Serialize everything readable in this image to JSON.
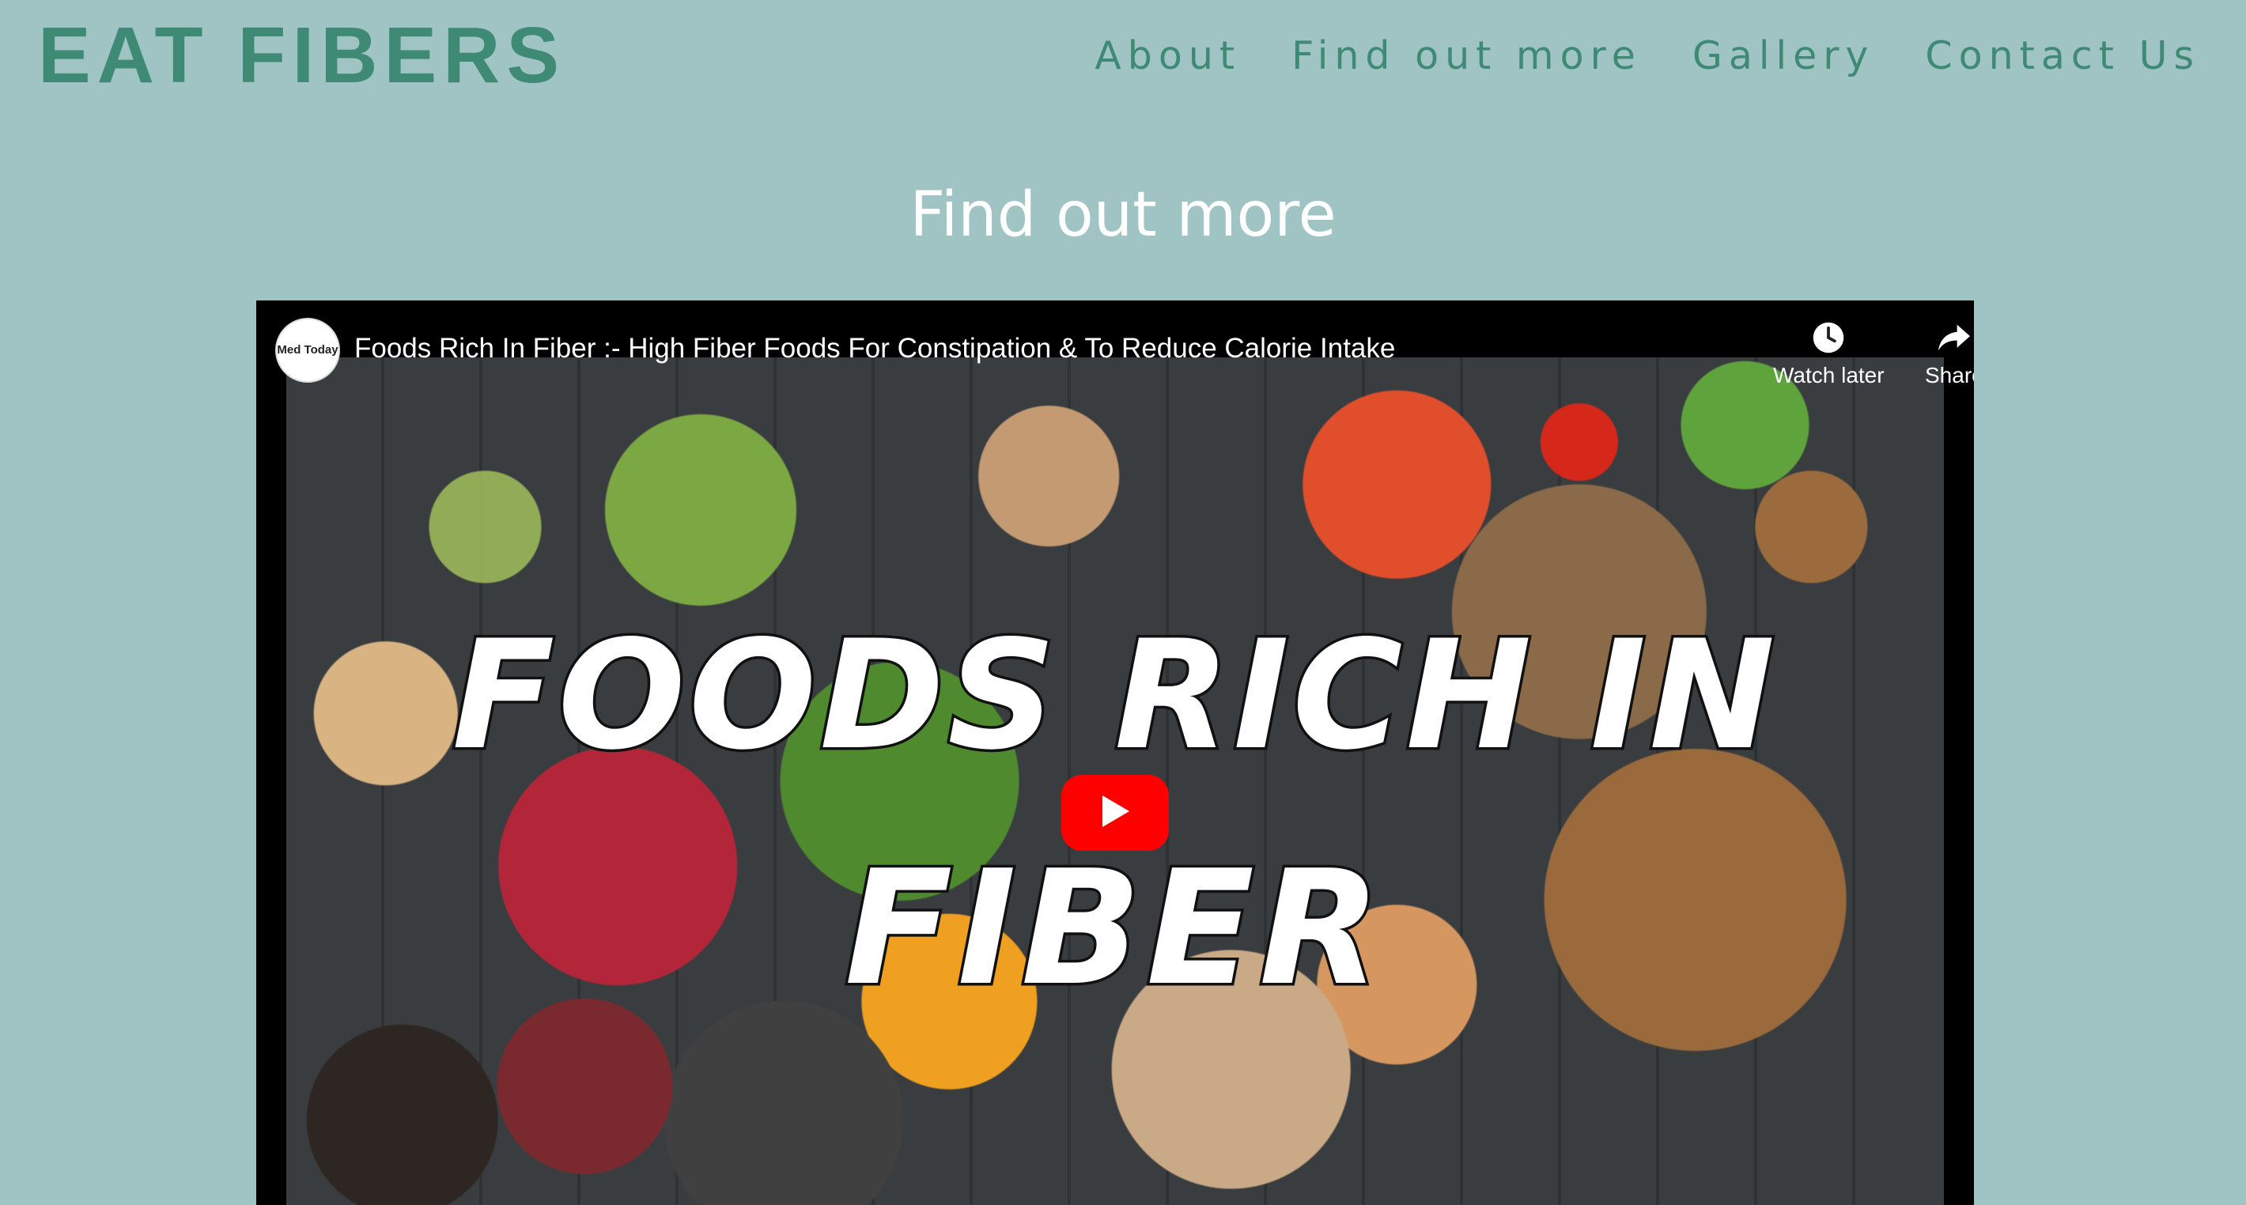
{
  "header": {
    "logo": "EAT FIBERS",
    "nav": [
      {
        "label": "About"
      },
      {
        "label": "Find out more"
      },
      {
        "label": "Gallery"
      },
      {
        "label": "Contact Us"
      }
    ]
  },
  "main": {
    "section_title": "Find out more",
    "video": {
      "title": "Foods Rich In Fiber :- High Fiber Foods For Constipation & To Reduce Calorie Intake",
      "channel_avatar_text": "Med Today",
      "watch_later_label": "Watch later",
      "share_label": "Share",
      "thumbnail_text_line1": "FOODS RICH IN",
      "thumbnail_text_line2": "FIBER",
      "icons": {
        "watch_later": "clock-icon",
        "share": "share-arrow-icon",
        "play": "play-icon"
      }
    }
  },
  "colors": {
    "background": "#a0c4c3",
    "brand_green": "#3e8a74",
    "youtube_red": "#ff0000"
  }
}
